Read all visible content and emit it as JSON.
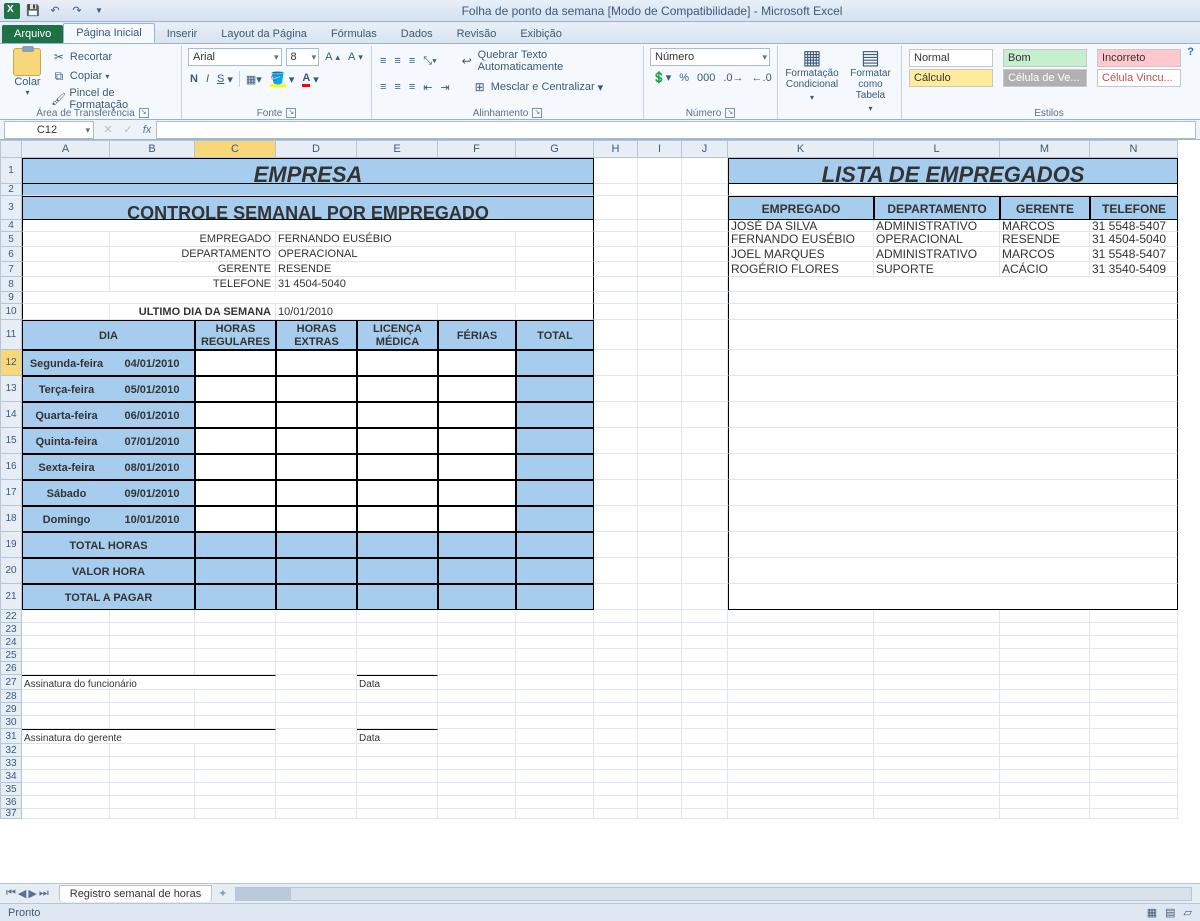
{
  "title": "Folha de ponto da semana  [Modo de Compatibilidade] - Microsoft Excel",
  "tabs": {
    "file": "Arquivo",
    "home": "Página Inicial",
    "insert": "Inserir",
    "layout": "Layout da Página",
    "formulas": "Fórmulas",
    "data": "Dados",
    "review": "Revisão",
    "view": "Exibição"
  },
  "ribbon": {
    "clipboard": {
      "paste": "Colar",
      "cut": "Recortar",
      "copy": "Copiar",
      "painter": "Pincel de Formatação",
      "label": "Área de Transferência"
    },
    "font": {
      "name": "Arial",
      "size": "8",
      "label": "Fonte"
    },
    "align": {
      "wrap": "Quebrar Texto Automaticamente",
      "merge": "Mesclar e Centralizar",
      "label": "Alinhamento"
    },
    "number": {
      "format": "Número",
      "label": "Número"
    },
    "fmt": {
      "cond": "Formatação Condicional",
      "table": "Formatar como Tabela",
      "label": ""
    },
    "styles": {
      "normal": "Normal",
      "bom": "Bom",
      "incorreto": "Incorreto",
      "calculo": "Cálculo",
      "celula_ve": "Célula de Ve...",
      "vincu": "Célula Vincu...",
      "label": "Estilos"
    }
  },
  "namebox": "C12",
  "colhdrs": [
    "A",
    "B",
    "C",
    "D",
    "E",
    "F",
    "G",
    "H",
    "I",
    "J",
    "K",
    "L",
    "M",
    "N"
  ],
  "rowcount": 37,
  "sheet": {
    "empresa": "EMPRESA",
    "titulo": "CONTROLE SEMANAL POR EMPREGADO",
    "labels": {
      "empregado": "EMPREGADO",
      "departamento": "DEPARTAMENTO",
      "gerente": "GERENTE",
      "telefone": "TELEFONE",
      "ultimo": "ULTIMO DIA DA SEMANA"
    },
    "empregado": "FERNANDO EUSÉBIO",
    "departamento": "OPERACIONAL",
    "gerente": "RESENDE",
    "telefone": "31 4504-5040",
    "ultimo": "10/01/2010",
    "cols": {
      "dia": "DIA",
      "reg": "HORAS REGULARES",
      "ext": "HORAS EXTRAS",
      "lic": "LICENÇA MÉDICA",
      "fer": "FÉRIAS",
      "tot": "TOTAL"
    },
    "dias": [
      {
        "d": "Segunda-feira",
        "dt": "04/01/2010"
      },
      {
        "d": "Terça-feira",
        "dt": "05/01/2010"
      },
      {
        "d": "Quarta-feira",
        "dt": "06/01/2010"
      },
      {
        "d": "Quinta-feira",
        "dt": "07/01/2010"
      },
      {
        "d": "Sexta-feira",
        "dt": "08/01/2010"
      },
      {
        "d": "Sábado",
        "dt": "09/01/2010"
      },
      {
        "d": "Domingo",
        "dt": "10/01/2010"
      }
    ],
    "totals": {
      "h": "TOTAL HORAS",
      "v": "VALOR HORA",
      "p": "TOTAL A PAGAR"
    },
    "sig1": "Assinatura do funcionário",
    "sig2": "Assinatura do gerente",
    "data": "Data",
    "lista": {
      "title": "LISTA DE EMPREGADOS",
      "h": {
        "emp": "EMPREGADO",
        "dep": "DEPARTAMENTO",
        "ger": "GERENTE",
        "tel": "TELEFONE"
      },
      "rows": [
        {
          "emp": "JOSÉ DA SILVA",
          "dep": "ADMINISTRATIVO",
          "ger": "MARCOS",
          "tel": "31 5548-5407"
        },
        {
          "emp": "FERNANDO EUSÉBIO",
          "dep": "OPERACIONAL",
          "ger": "RESENDE",
          "tel": "31 4504-5040"
        },
        {
          "emp": "JOEL MARQUES",
          "dep": "ADMINISTRATIVO",
          "ger": "MARCOS",
          "tel": "31 5548-5407"
        },
        {
          "emp": "ROGÉRIO FLORES",
          "dep": "SUPORTE",
          "ger": "ACÁCIO",
          "tel": "31 3540-5409"
        }
      ]
    }
  },
  "sheet_tab": "Registro semanal de horas",
  "status": "Pronto"
}
